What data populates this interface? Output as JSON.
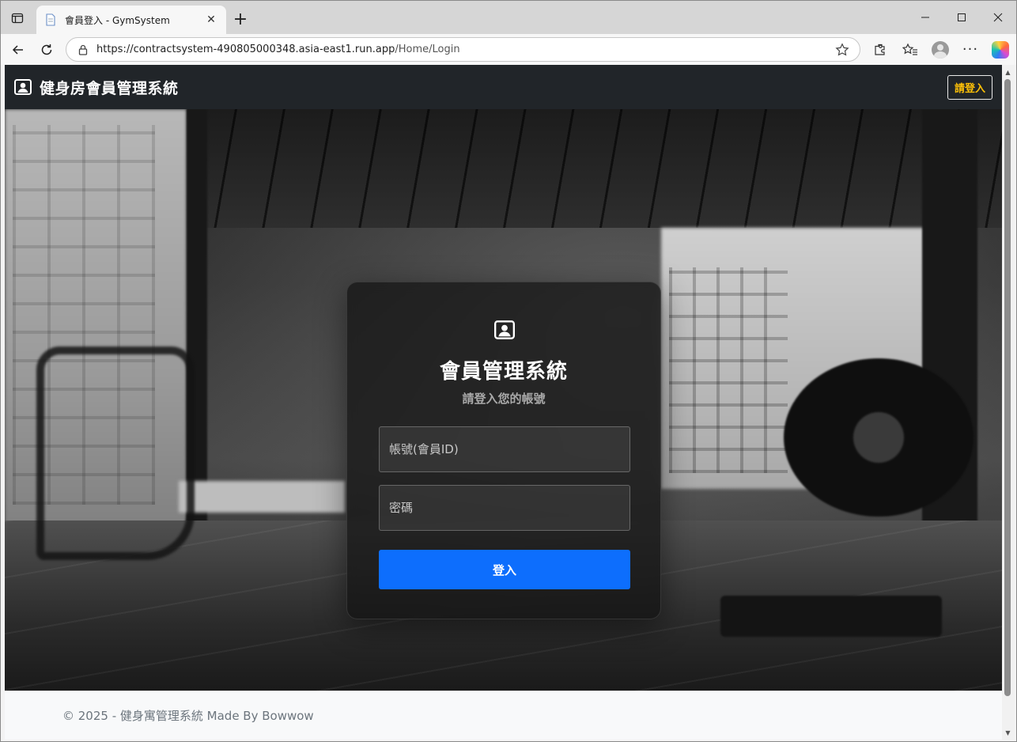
{
  "browser": {
    "tab_title": "會員登入 - GymSystem",
    "url_host": "https://contractsystem-490805000348.asia-east1.run.app",
    "url_path": "/Home/Login"
  },
  "navbar": {
    "brand": "健身房會員管理系統",
    "login_button": "請登入"
  },
  "card": {
    "title": "會員管理系統",
    "subtitle": "請登入您的帳號",
    "username_placeholder": "帳號(會員ID)",
    "password_placeholder": "密碼",
    "submit_label": "登入"
  },
  "footer": {
    "text": "© 2025 - 健身寓管理系統 Made By Bowwow"
  },
  "colors": {
    "navbar_bg": "#212529",
    "login_button_text": "#ffc107",
    "primary_button": "#0d6efd"
  }
}
